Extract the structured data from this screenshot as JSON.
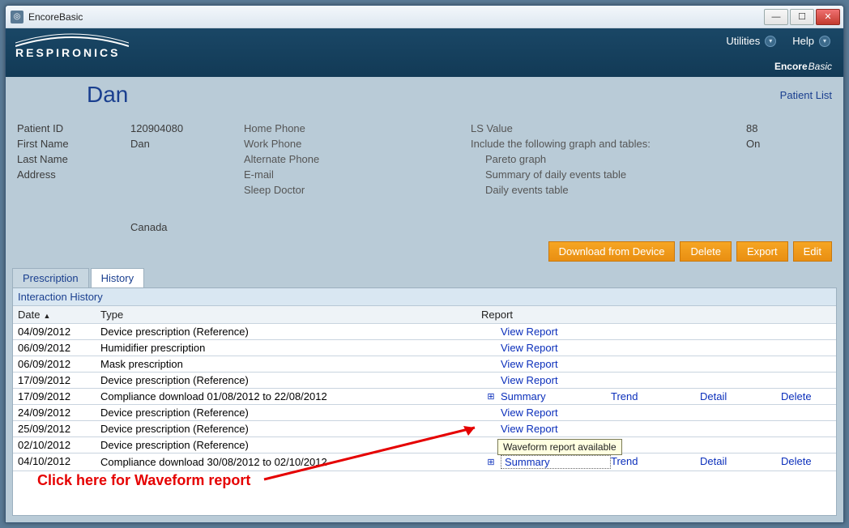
{
  "window": {
    "title": "EncoreBasic"
  },
  "brand": {
    "name": "RESPIRONICS",
    "sub_bold": "Encore",
    "sub_italic": "Basic"
  },
  "menu": {
    "utilities": "Utilities",
    "help": "Help"
  },
  "patient": {
    "name": "Dan",
    "list_link": "Patient List",
    "labels": {
      "patient_id": "Patient ID",
      "first_name": "First Name",
      "last_name": "Last Name",
      "address": "Address",
      "home_phone": "Home Phone",
      "work_phone": "Work Phone",
      "alt_phone": "Alternate Phone",
      "email": "E-mail",
      "sleep_doctor": "Sleep Doctor",
      "ls_value": "LS Value",
      "include": "Include the following graph and tables:",
      "pareto": "Pareto graph",
      "summary_daily": "Summary of daily events table",
      "daily_events": "Daily events table"
    },
    "values": {
      "patient_id": "120904080",
      "first_name": "Dan",
      "country": "Canada",
      "ls_value": "88",
      "include": "On"
    }
  },
  "actions": {
    "download": "Download from Device",
    "delete": "Delete",
    "export": "Export",
    "edit": "Edit"
  },
  "tabs": {
    "prescription": "Prescription",
    "history": "History"
  },
  "history": {
    "title": "Interaction History",
    "columns": {
      "date": "Date",
      "type": "Type",
      "report": "Report"
    },
    "links": {
      "view": "View Report",
      "summary": "Summary",
      "trend": "Trend",
      "detail": "Detail",
      "delete": "Delete"
    },
    "rows": [
      {
        "date": "04/09/2012",
        "type": "Device prescription (Reference)",
        "kind": "view"
      },
      {
        "date": "06/09/2012",
        "type": "Humidifier prescription",
        "kind": "view"
      },
      {
        "date": "06/09/2012",
        "type": "Mask prescription",
        "kind": "view"
      },
      {
        "date": "17/09/2012",
        "type": "Device prescription (Reference)",
        "kind": "view"
      },
      {
        "date": "17/09/2012",
        "type": "Compliance download 01/08/2012 to 22/08/2012",
        "kind": "compliance"
      },
      {
        "date": "24/09/2012",
        "type": "Device prescription (Reference)",
        "kind": "view"
      },
      {
        "date": "25/09/2012",
        "type": "Device prescription (Reference)",
        "kind": "view"
      },
      {
        "date": "02/10/2012",
        "type": "Device prescription (Reference)",
        "kind": "view"
      },
      {
        "date": "04/10/2012",
        "type": "Compliance download 30/08/2012 to 02/10/2012",
        "kind": "compliance_boxed"
      }
    ]
  },
  "tooltip": "Waveform report available",
  "annotation": "Click here for Waveform report"
}
